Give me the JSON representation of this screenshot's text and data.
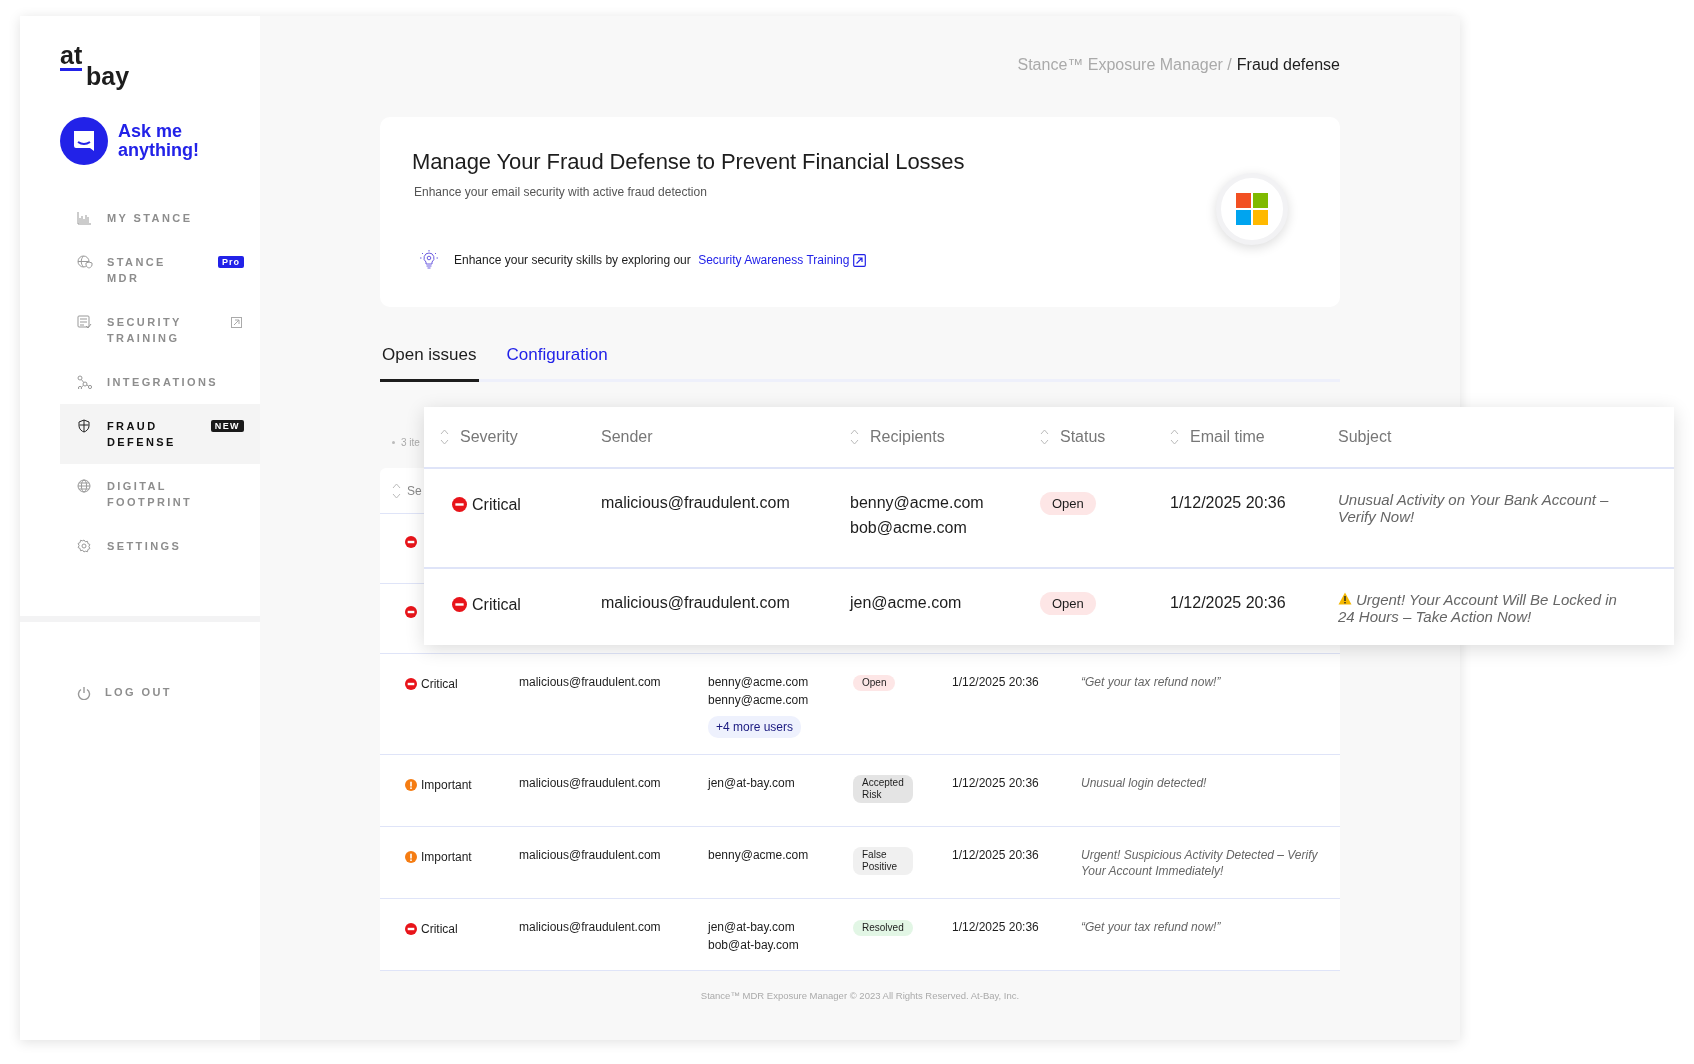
{
  "sidebar": {
    "logo": {
      "top": "at",
      "bottom": "bay"
    },
    "assistant": {
      "label": "Ask me anything!"
    },
    "items": [
      {
        "label": "MY STANCE",
        "selected": false
      },
      {
        "label": "STANCE MDR",
        "selected": false,
        "badge": {
          "kind": "pro",
          "text": "Pro"
        }
      },
      {
        "label": "SECURITY TRAINING",
        "selected": false,
        "external": true
      },
      {
        "label": "INTEGRATIONS",
        "selected": false
      },
      {
        "label": "FRAUD DEFENSE",
        "selected": true,
        "badge": {
          "kind": "new",
          "text": "NEW"
        }
      },
      {
        "label": "DIGITAL FOOTPRINT",
        "selected": false
      },
      {
        "label": "SETTINGS",
        "selected": false
      }
    ],
    "logout": {
      "label": "LOG OUT"
    }
  },
  "breadcrumb": [
    {
      "text": "Stance™ Exposure Manager /",
      "current": false
    },
    {
      "text": "Fraud defense",
      "current": true
    }
  ],
  "intro_card": {
    "title": "Manage Your Fraud Defense to Prevent Financial Losses",
    "subtitle": "Enhance your email security with active fraud detection",
    "tip": "Enhance your security skills by exploring our",
    "tip_link": "Security Awareness Training"
  },
  "tabs": [
    {
      "label": "Open issues",
      "selected": true
    },
    {
      "label": "Configuration",
      "selected": false
    }
  ],
  "issues_table": {
    "count_label": "3 ite",
    "first_column_partial": "Se",
    "covered_rows": [
      {
        "kind": "critical"
      },
      {
        "kind": "critical"
      }
    ],
    "rows": [
      {
        "severity": {
          "kind": "critical",
          "label": "Critical"
        },
        "sender": "malicious@fraudulent.com",
        "recipients": [
          "benny@acme.com",
          "benny@acme.com"
        ],
        "more": "+4 more users",
        "status": {
          "kind": "open",
          "label": "Open"
        },
        "time": "1/12/2025 20:36",
        "subject": "“Get your tax refund now!”"
      },
      {
        "severity": {
          "kind": "important",
          "label": "Important"
        },
        "sender": "malicious@fraudulent.com",
        "recipients": [
          "jen@at-bay.com"
        ],
        "status": {
          "kind": "accepted",
          "label": "Accepted Risk"
        },
        "time": "1/12/2025 20:36",
        "subject": "Unusual login detected!"
      },
      {
        "severity": {
          "kind": "important",
          "label": "Important"
        },
        "sender": "malicious@fraudulent.com",
        "recipients": [
          "benny@acme.com"
        ],
        "status": {
          "kind": "false_positive",
          "label": "False Positive"
        },
        "time": "1/12/2025 20:36",
        "subject": "Urgent! Suspicious Activity Detected – Verify Your Account Immediately!"
      },
      {
        "severity": {
          "kind": "critical",
          "label": "Critical"
        },
        "sender": "malicious@fraudulent.com",
        "recipients": [
          "jen@at-bay.com",
          "bob@at-bay.com"
        ],
        "status": {
          "kind": "resolved",
          "label": "Resolved"
        },
        "time": "1/12/2025 20:36",
        "subject": "“Get your tax refund now!”"
      }
    ]
  },
  "footer": "Stance™ MDR Exposure Manager © 2023 All Rights Reserved. At-Bay, Inc.",
  "overlay_table": {
    "columns": [
      {
        "label": "Severity",
        "sortable": true
      },
      {
        "label": "Sender",
        "sortable": false
      },
      {
        "label": "Recipients",
        "sortable": true
      },
      {
        "label": "Status",
        "sortable": true
      },
      {
        "label": "Email time",
        "sortable": true
      },
      {
        "label": "Subject",
        "sortable": false
      }
    ],
    "rows": [
      {
        "severity": {
          "kind": "critical",
          "label": "Critical"
        },
        "sender": "malicious@fraudulent.com",
        "recipients": [
          "benny@acme.com",
          "bob@acme.com"
        ],
        "status": {
          "kind": "open",
          "label": "Open"
        },
        "time": "1/12/2025 20:36",
        "subject": "Unusual Activity on Your Bank Account – Verify Now!",
        "warning": false
      },
      {
        "severity": {
          "kind": "critical",
          "label": "Critical"
        },
        "sender": "malicious@fraudulent.com",
        "recipients": [
          "jen@acme.com"
        ],
        "status": {
          "kind": "open",
          "label": "Open"
        },
        "time": "1/12/2025 20:36",
        "subject": "Urgent! Your Account Will Be Locked in 24 Hours – Take Action Now!",
        "warning": true
      }
    ]
  }
}
